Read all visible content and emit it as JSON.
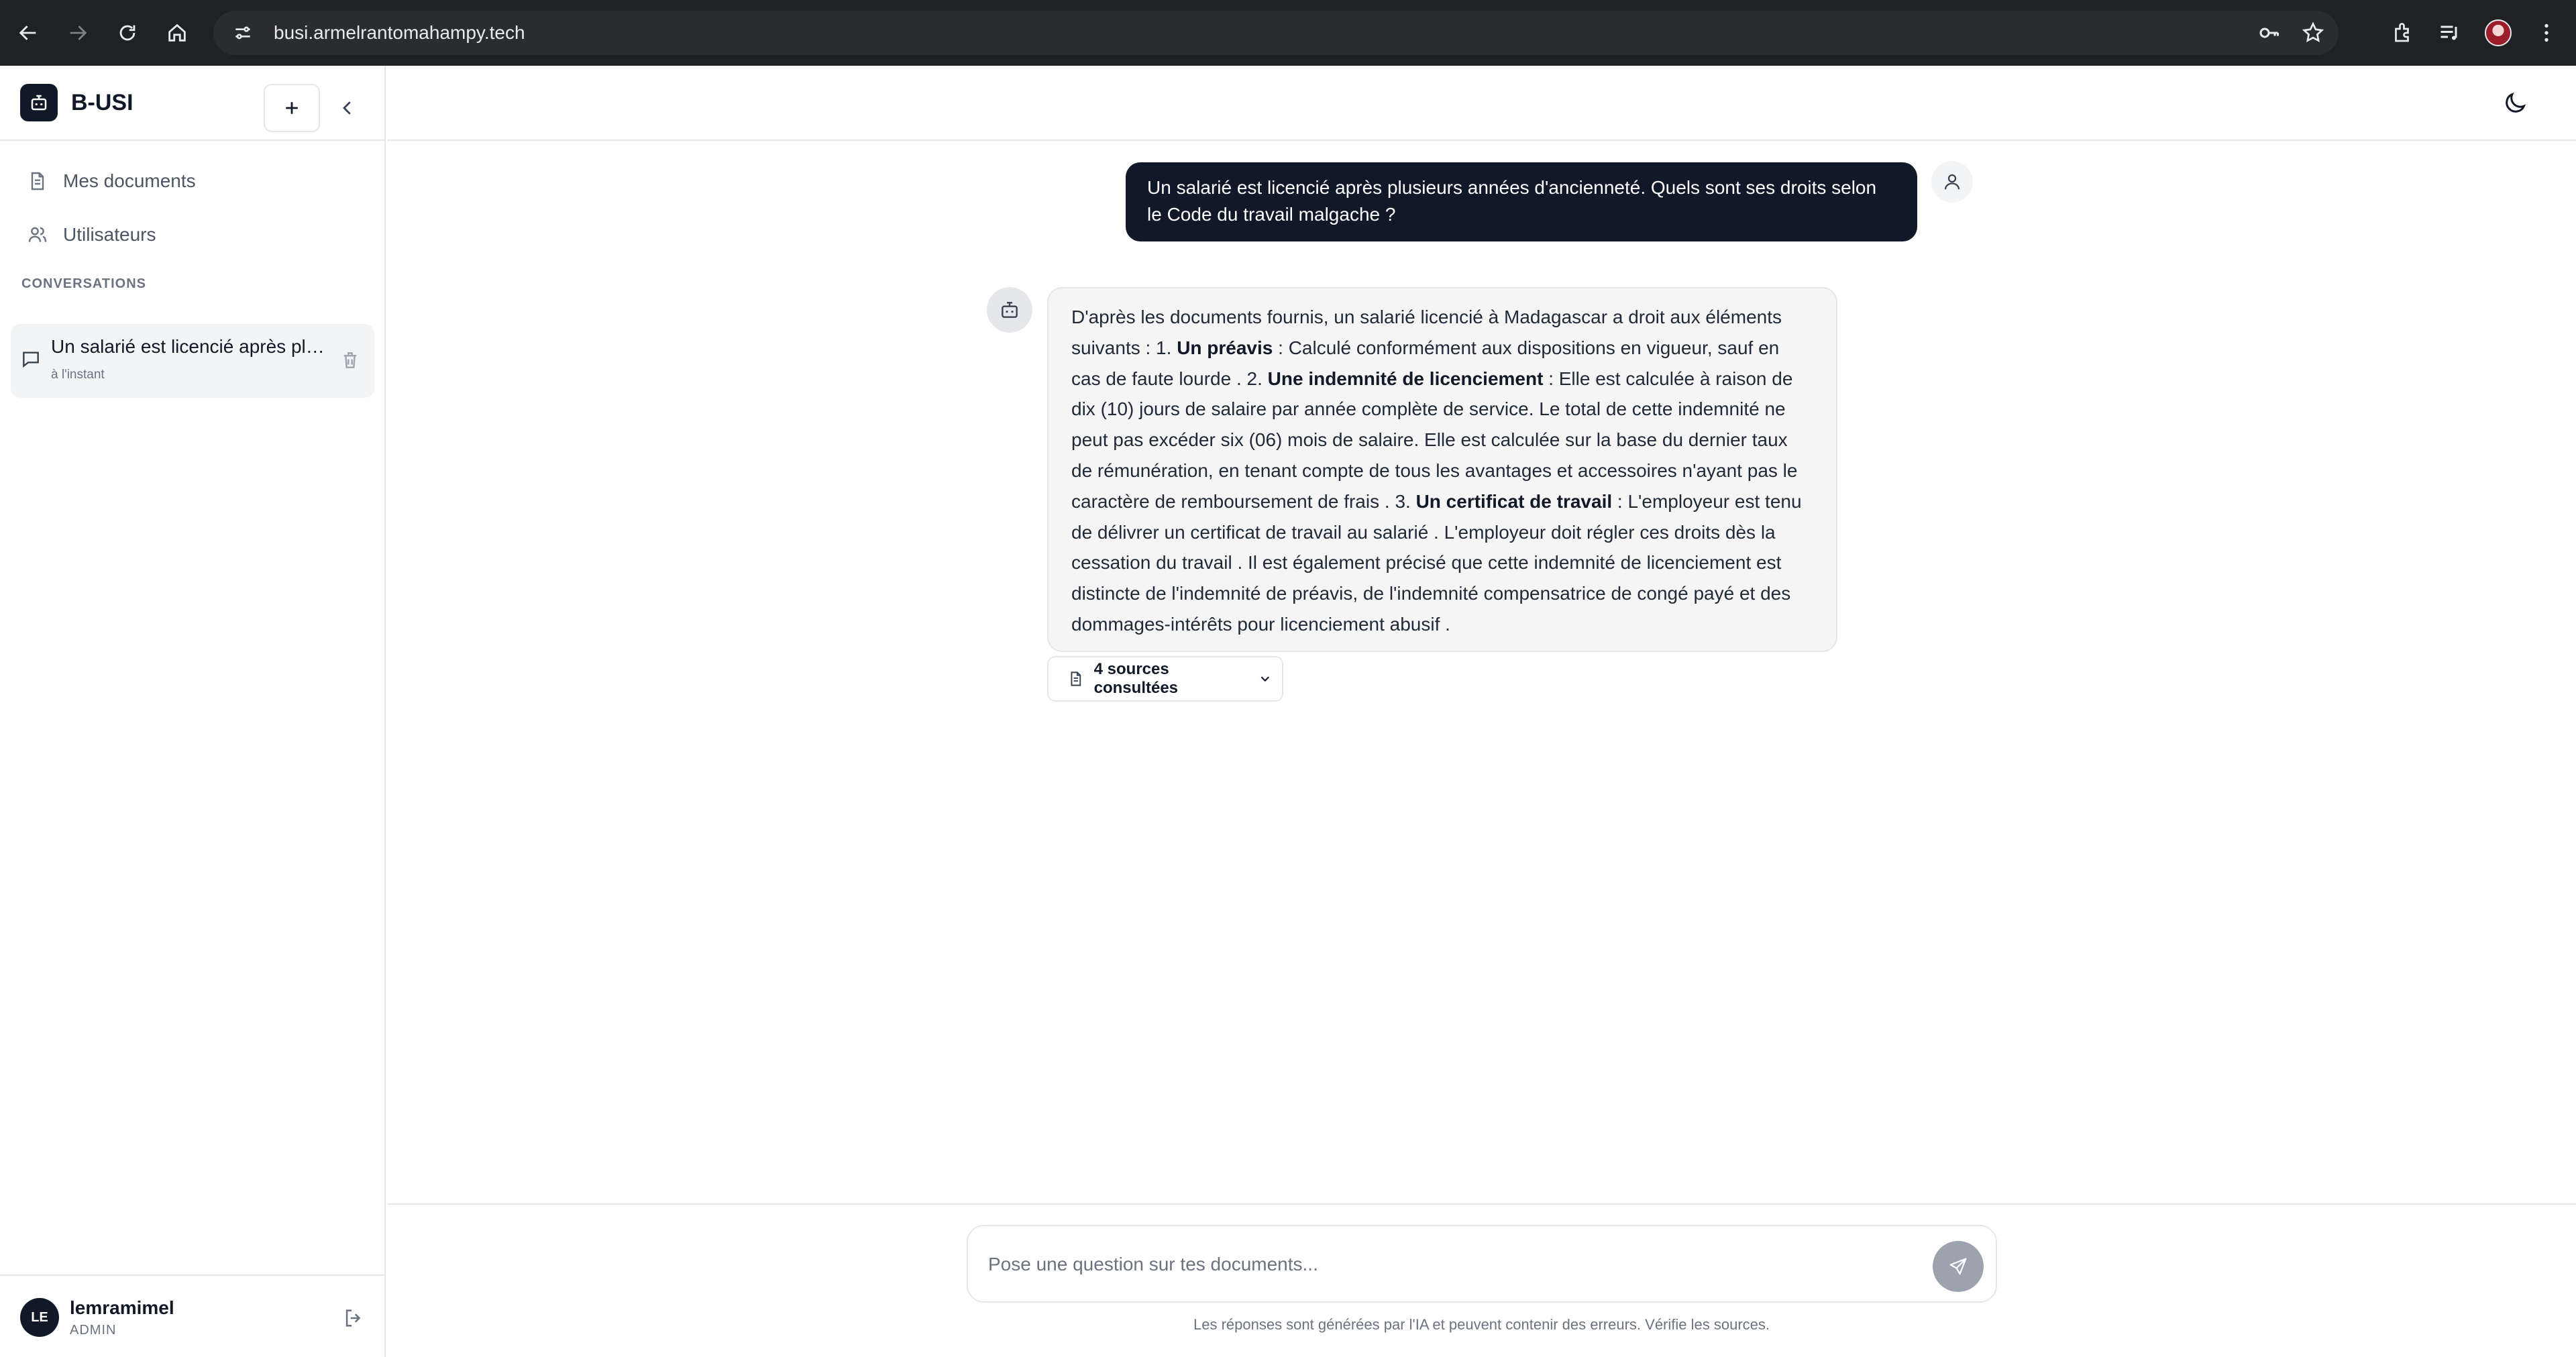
{
  "browser": {
    "url": "busi.armelrantomahampy.tech"
  },
  "app": {
    "brand": "B-USI",
    "nav": [
      {
        "label": "Mes documents",
        "icon": "document-icon"
      },
      {
        "label": "Utilisateurs",
        "icon": "users-icon"
      }
    ],
    "conversations_label": "CONVERSATIONS",
    "conversation": {
      "title": "Un salarié est licencié après plusieurs années d'ancienneté. Quels sont ses droits selon le Code du travail malgache ?",
      "time": "à l'instant"
    },
    "user": {
      "initials": "LE",
      "name": "lemramimel",
      "role": "ADMIN"
    }
  },
  "chat": {
    "user_message": "Un salarié est licencié après plusieurs années d'ancienneté. Quels sont ses droits selon le Code du travail malgache ?",
    "bot_message": {
      "p1": "D'après les documents fournis, un salarié licencié à Madagascar a droit aux éléments suivants : 1. ",
      "b1": "Un préavis",
      "p2": " : Calculé conformément aux dispositions en vigueur, sauf en cas de faute lourde . 2. ",
      "b2": "Une indemnité de licenciement",
      "p3": " : Elle est calculée à raison de dix (10) jours de salaire par année complète de service. Le total de cette indemnité ne peut pas excéder six (06) mois de salaire. Elle est calculée sur la base du dernier taux de rémunération, en tenant compte de tous les avantages et accessoires n'ayant pas le caractère de remboursement de frais . 3. ",
      "b3": "Un certificat de travail",
      "p4": " : L'employeur est tenu de délivrer un certificat de travail au salarié . L'employeur doit régler ces droits dès la cessation du travail . Il est également précisé que cette indemnité de licenciement est distincte de l'indemnité de préavis, de l'indemnité compensatrice de congé payé et des dommages-intérêts pour licenciement abusif ."
    },
    "sources_label": "4 sources consultées"
  },
  "composer": {
    "placeholder": "Pose une question sur tes documents...",
    "disclaimer": "Les réponses sont générées par l'IA et peuvent contenir des erreurs. Vérifie les sources."
  }
}
